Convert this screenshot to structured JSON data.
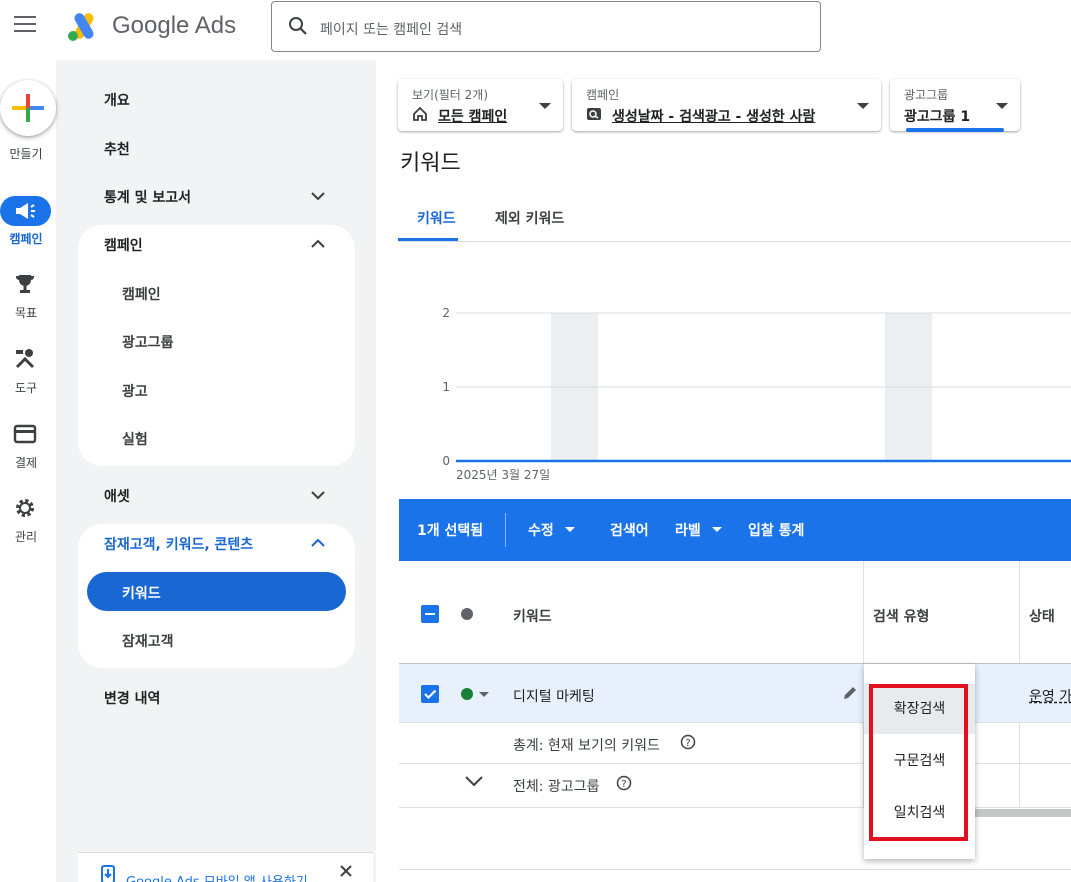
{
  "app": {
    "name": "Google Ads"
  },
  "search": {
    "placeholder": "페이지 또는 캠페인 검색"
  },
  "rail": {
    "create_label": "만들기",
    "items": [
      {
        "label": "캠페인",
        "icon": "campaign-megaphone-icon",
        "active": true
      },
      {
        "label": "목표",
        "icon": "trophy-icon"
      },
      {
        "label": "도구",
        "icon": "tools-icon"
      },
      {
        "label": "결제",
        "icon": "credit-card-icon"
      },
      {
        "label": "관리",
        "icon": "gear-icon"
      }
    ]
  },
  "sidebar": {
    "overview": "개요",
    "recommendations": "추천",
    "reports": "통계 및 보고서",
    "campaigns_group": "캠페인",
    "campaigns_sub": [
      "캠페인",
      "광고그룹",
      "광고",
      "실험"
    ],
    "assets": "애셋",
    "audiences_group": "잠재고객, 키워드, 콘텐츠",
    "keywords": "키워드",
    "audiences": "잠재고객",
    "change_history": "변경 내역",
    "mobile_app": "Google Ads 모바일 앱 사용하기"
  },
  "filters": {
    "view": {
      "label": "보기(필터 2개)",
      "value": "모든 캠페인"
    },
    "campaign": {
      "label": "캠페인",
      "value": "생성날짜 - 검색광고 - 생성한 사람"
    },
    "adgroup": {
      "label": "광고그룹",
      "value": "광고그룹 1"
    }
  },
  "page": {
    "title": "키워드",
    "tabs": [
      "키워드",
      "제외 키워드"
    ]
  },
  "chart_data": {
    "type": "line",
    "title": "",
    "xlabel": "",
    "ylabel": "",
    "yticks": [
      "2",
      "1",
      "0"
    ],
    "ylim": [
      0,
      2
    ],
    "x_start_label": "2025년 3월 27일",
    "series": [
      {
        "values": [
          0,
          0,
          0,
          0,
          0
        ]
      }
    ],
    "grid": true
  },
  "toolbar": {
    "selected": "1개 선택됨",
    "edit": "수정",
    "search_terms": "검색어",
    "label": "라벨",
    "auction": "입찰 통계"
  },
  "table": {
    "headers": {
      "keyword": "키워드",
      "match_type": "검색 유형",
      "status": "상태"
    },
    "row": {
      "keyword": "디지털 마케팅",
      "status": "운영 가"
    },
    "total_view": "총계: 현재 보기의 키워드",
    "total_adgroup": "전체: 광고그룹"
  },
  "dropdown": {
    "options": [
      "확장검색",
      "구문검색",
      "일치검색"
    ]
  },
  "colors": {
    "primary": "#1a73e8",
    "highlight": "#e0101f",
    "status_green": "#188038"
  }
}
